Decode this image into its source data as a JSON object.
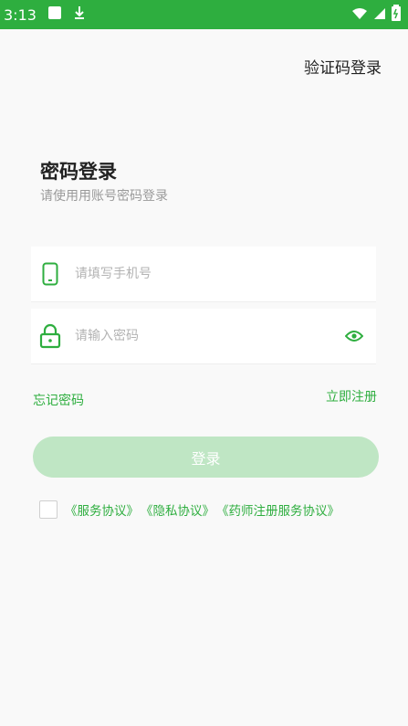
{
  "status": {
    "time": "3:13",
    "icons": [
      "square-icon",
      "download-icon",
      "wifi-icon",
      "signal-icon",
      "battery-icon"
    ]
  },
  "header": {
    "switch_login": "验证码登录"
  },
  "form": {
    "title": "密码登录",
    "subtitle": "请使用用账号密码登录",
    "phone_placeholder": "请填写手机号",
    "password_placeholder": "请输入密码",
    "forgot": "忘记密码",
    "register": "立即注册",
    "login": "登录"
  },
  "agreement": {
    "checked": false,
    "links": [
      "《服务协议》",
      "《隐私协议》",
      "《药师注册服务协议》"
    ]
  },
  "colors": {
    "accent": "#2eae3f",
    "button_disabled": "#bfe6c4"
  }
}
